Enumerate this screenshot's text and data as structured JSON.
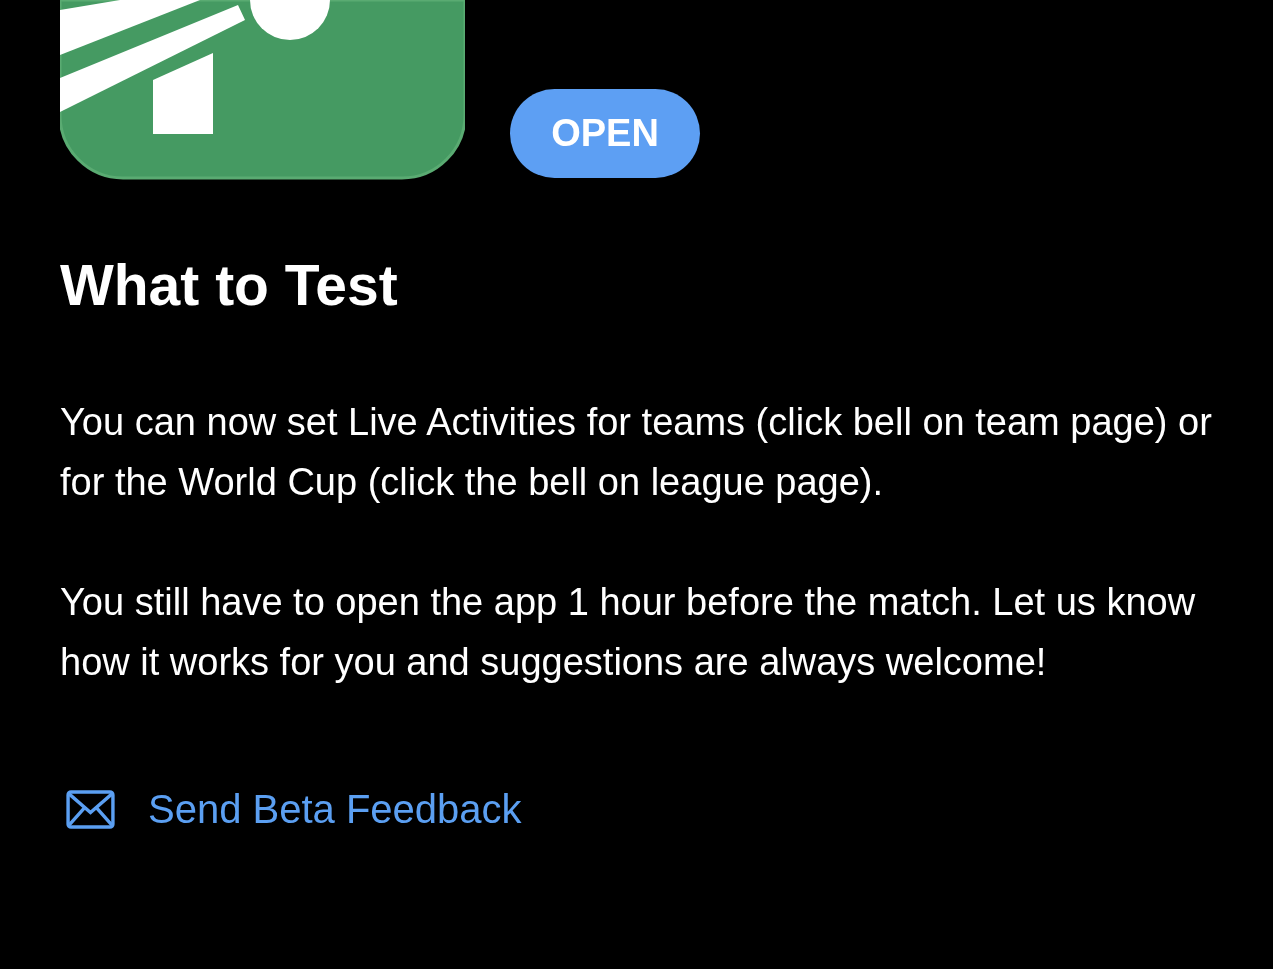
{
  "app": {
    "open_button": "OPEN"
  },
  "what_to_test": {
    "heading": "What to Test",
    "paragraphs": [
      "You can now set Live Activities for teams (click bell on team page) or for the World Cup (click the bell on league page).",
      "You still have to open the app 1 hour before the match. Let us know how it works for you and suggestions are always welcome!"
    ]
  },
  "feedback_link": "Send Beta Feedback"
}
